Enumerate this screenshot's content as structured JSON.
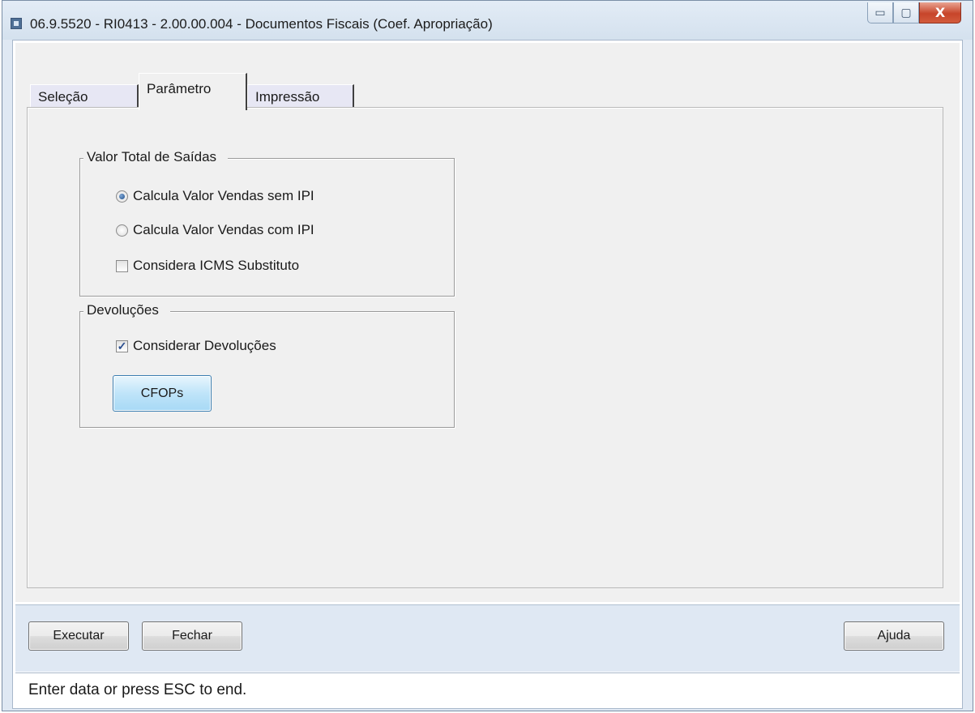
{
  "window": {
    "title": "06.9.5520 - RI0413 - 2.00.00.004 - Documentos Fiscais (Coef. Apropriação)",
    "minimize_glyph": "▭",
    "maximize_glyph": "▢",
    "close_glyph": "X"
  },
  "tabs": [
    {
      "label": "Seleção",
      "active": false
    },
    {
      "label": "Parâmetro",
      "active": true
    },
    {
      "label": "Impressão",
      "active": false
    }
  ],
  "valor_total": {
    "title": "Valor Total de Saídas",
    "radio_sem_ipi": {
      "label": "Calcula Valor Vendas sem IPI",
      "checked": true
    },
    "radio_com_ipi": {
      "label": "Calcula Valor Vendas com IPI",
      "checked": false
    },
    "icms_substituto": {
      "label": "Considera ICMS Substituto",
      "checked": false
    }
  },
  "devolucoes": {
    "title": "Devoluções",
    "considerar": {
      "label": "Considerar Devoluções",
      "checked": true,
      "check_glyph": "✓"
    },
    "cfops_label": "CFOPs"
  },
  "buttons": {
    "executar": "Executar",
    "fechar": "Fechar",
    "ajuda": "Ajuda"
  },
  "status": {
    "text": "Enter data or press ESC to end."
  }
}
